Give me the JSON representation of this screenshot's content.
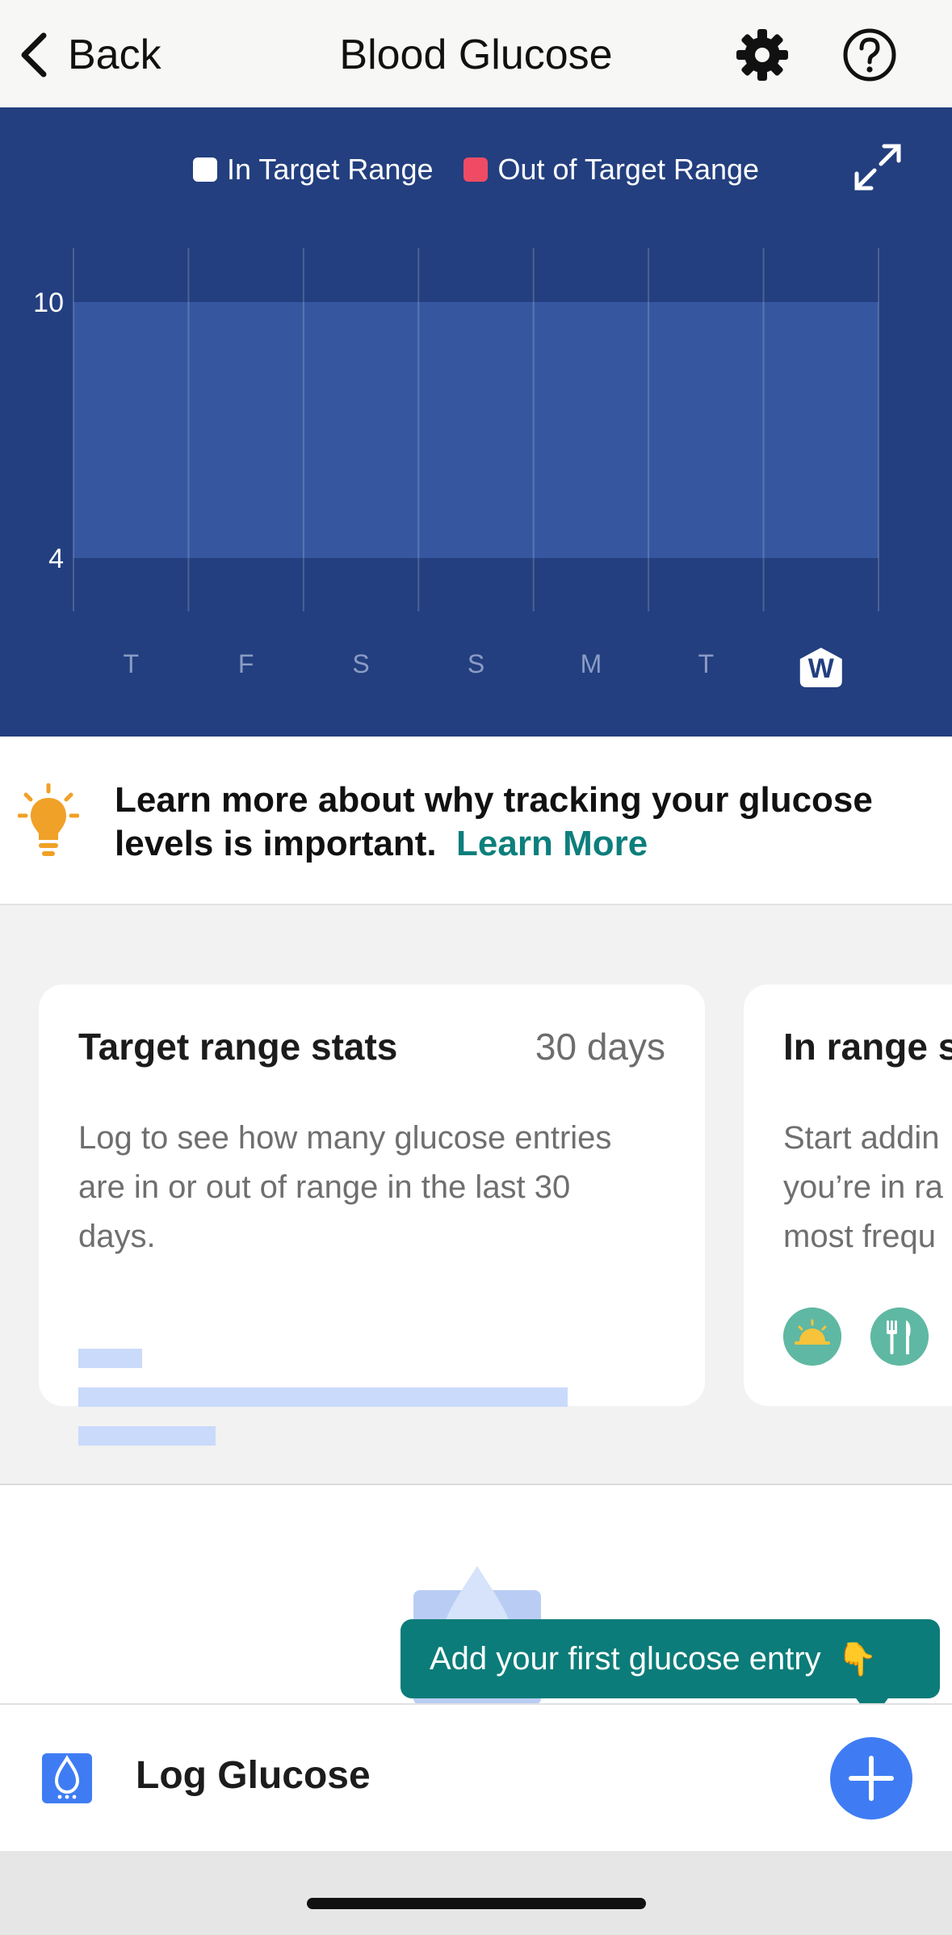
{
  "nav": {
    "back_label": "Back",
    "title": "Blood Glucose",
    "settings_icon": "gear-icon",
    "help_icon": "question-circle-icon"
  },
  "chart_data": {
    "type": "area",
    "legend": [
      {
        "name": "In Target Range",
        "color": "#ffffff"
      },
      {
        "name": "Out of Target Range",
        "color": "#ef4b64"
      }
    ],
    "legend_placement": "top-center",
    "target_range": [
      4,
      10
    ],
    "y_ticks": [
      "10",
      "4"
    ],
    "x": [
      "T",
      "F",
      "S",
      "S",
      "M",
      "T",
      "W"
    ],
    "selected_day_index": 6,
    "series": [],
    "grid": true,
    "colors": {
      "background": "#233f7f",
      "band": "#3657a0"
    }
  },
  "chart": {
    "expand_icon": "expand-arrows-icon"
  },
  "learn": {
    "text": "Learn more about why tracking your glucose levels is important.",
    "link_label": "Learn More",
    "icon": "lightbulb-icon"
  },
  "cards": [
    {
      "title": "Target range stats",
      "period": "30 days",
      "description": "Log to see how many glucose entries\nare in or out of range in the last 30\ndays.",
      "skeleton_fill": [
        0.13,
        1.0,
        0.28
      ]
    },
    {
      "title": "In range s",
      "description": "Start addin\nyou’re in ra\nmost frequ",
      "icons": [
        "sunrise-icon",
        "fork-knife-icon"
      ]
    }
  ],
  "tooltip": {
    "text": "Add your first glucose entry",
    "emoji": "👇"
  },
  "log": {
    "label": "Log Glucose",
    "icon": "glucose-drop-icon",
    "add_icon": "plus-icon"
  },
  "colors": {
    "teal": "#0b7c79",
    "blue": "#3f7cf4",
    "chart_bg": "#233f7f"
  }
}
